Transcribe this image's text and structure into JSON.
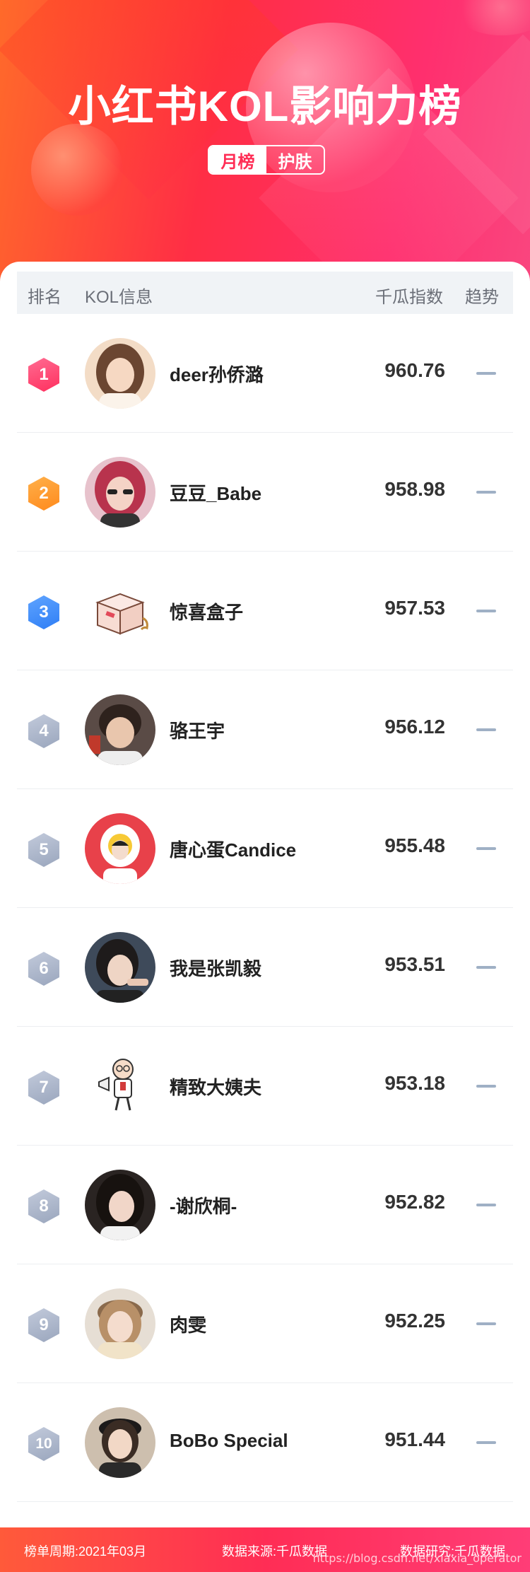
{
  "header": {
    "title": "小红书KOL影响力榜",
    "tabs": [
      {
        "label": "月榜",
        "active": true
      },
      {
        "label": "护肤",
        "active": false
      }
    ]
  },
  "table": {
    "columns": {
      "rank": "排名",
      "kol": "KOL信息",
      "index": "千瓜指数",
      "trend": "趋势"
    },
    "rows": [
      {
        "rank": "1",
        "name": "deer孙侨潞",
        "score": "960.76",
        "avatar": "avatar-icon"
      },
      {
        "rank": "2",
        "name": "豆豆_Babe",
        "score": "958.98",
        "avatar": "avatar-icon"
      },
      {
        "rank": "3",
        "name": "惊喜盒子",
        "score": "957.53",
        "avatar": "gift-box-icon"
      },
      {
        "rank": "4",
        "name": "骆王宇",
        "score": "956.12",
        "avatar": "avatar-icon"
      },
      {
        "rank": "5",
        "name": "唐心蛋Candice",
        "score": "955.48",
        "avatar": "avatar-icon"
      },
      {
        "rank": "6",
        "name": "我是张凯毅",
        "score": "953.51",
        "avatar": "avatar-icon"
      },
      {
        "rank": "7",
        "name": "精致大姨夫",
        "score": "953.18",
        "avatar": "cartoon-man-icon"
      },
      {
        "rank": "8",
        "name": "-谢欣桐-",
        "score": "952.82",
        "avatar": "avatar-icon"
      },
      {
        "rank": "9",
        "name": "肉雯",
        "score": "952.25",
        "avatar": "avatar-icon"
      },
      {
        "rank": "10",
        "name": "BoBo Special",
        "score": "951.44",
        "avatar": "avatar-icon"
      }
    ]
  },
  "footer": {
    "period": "榜单周期:2021年03月",
    "source": "数据来源:千瓜数据",
    "research": "数据研究:千瓜数据",
    "watermark": "https://blog.csdn.net/xiaxia_operator"
  },
  "colors": {
    "brand": "#ff2d55",
    "rank1": "#ff3f6f",
    "rank2": "#ff9a2e",
    "rank3": "#3b8cf6",
    "rankOther": "#aeb8cc",
    "trend": "#9fb0c5"
  }
}
